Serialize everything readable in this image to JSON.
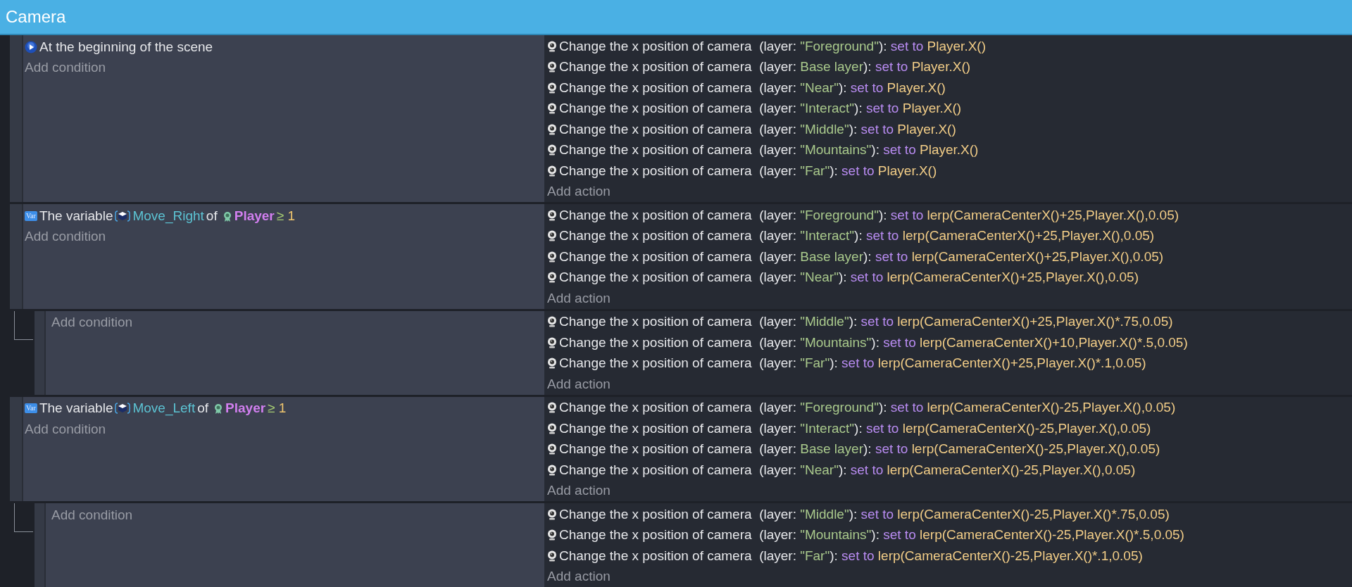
{
  "header": {
    "title": "Camera"
  },
  "events": [
    {
      "conditions": [
        {
          "kind": "scene_start",
          "text": "At the beginning of the scene"
        }
      ],
      "add_condition": "Add condition",
      "actions": [
        {
          "text": "Change the x position of camera",
          "open": "(layer:",
          "layer": "\"Foreground\"",
          "close": "):",
          "verb": "set to",
          "value": "Player.X()"
        },
        {
          "text": "Change the x position of camera",
          "open": "(layer:",
          "layer": "Base layer",
          "close": "):",
          "verb": "set to",
          "value": "Player.X()"
        },
        {
          "text": "Change the x position of camera",
          "open": "(layer:",
          "layer": "\"Near\"",
          "close": "):",
          "verb": "set to",
          "value": "Player.X()"
        },
        {
          "text": "Change the x position of camera",
          "open": "(layer:",
          "layer": "\"Interact\"",
          "close": "):",
          "verb": "set to",
          "value": "Player.X()"
        },
        {
          "text": "Change the x position of camera",
          "open": "(layer:",
          "layer": "\"Middle\"",
          "close": "):",
          "verb": "set to",
          "value": "Player.X()"
        },
        {
          "text": "Change the x position of camera",
          "open": "(layer:",
          "layer": "\"Mountains\"",
          "close": "):",
          "verb": "set to",
          "value": "Player.X()"
        },
        {
          "text": "Change the x position of camera",
          "open": "(layer:",
          "layer": "\"Far\"",
          "close": "):",
          "verb": "set to",
          "value": "Player.X()"
        }
      ],
      "add_action": "Add action"
    },
    {
      "conditions": [
        {
          "kind": "variable",
          "badge": "Var",
          "text": "The variable",
          "variable": "Move_Right",
          "of": "of",
          "object": "Player",
          "operator": "≥",
          "value": "1"
        }
      ],
      "add_condition": "Add condition",
      "actions": [
        {
          "text": "Change the x position of camera",
          "open": "(layer:",
          "layer": "\"Foreground\"",
          "close": "):",
          "verb": "set to",
          "value": "lerp(CameraCenterX()+25,Player.X(),0.05)"
        },
        {
          "text": "Change the x position of camera",
          "open": "(layer:",
          "layer": "\"Interact\"",
          "close": "):",
          "verb": "set to",
          "value": "lerp(CameraCenterX()+25,Player.X(),0.05)"
        },
        {
          "text": "Change the x position of camera",
          "open": "(layer:",
          "layer": "Base layer",
          "close": "):",
          "verb": "set to",
          "value": "lerp(CameraCenterX()+25,Player.X(),0.05)"
        },
        {
          "text": "Change the x position of camera",
          "open": "(layer:",
          "layer": "\"Near\"",
          "close": "):",
          "verb": "set to",
          "value": "lerp(CameraCenterX()+25,Player.X(),0.05)"
        }
      ],
      "add_action": "Add action",
      "children": [
        {
          "add_condition": "Add condition",
          "actions": [
            {
              "text": "Change the x position of camera",
              "open": "(layer:",
              "layer": "\"Middle\"",
              "close": "):",
              "verb": "set to",
              "value": "lerp(CameraCenterX()+25,Player.X()*.75,0.05)"
            },
            {
              "text": "Change the x position of camera",
              "open": "(layer:",
              "layer": "\"Mountains\"",
              "close": "):",
              "verb": "set to",
              "value": "lerp(CameraCenterX()+10,Player.X()*.5,0.05)"
            },
            {
              "text": "Change the x position of camera",
              "open": "(layer:",
              "layer": "\"Far\"",
              "close": "):",
              "verb": "set to",
              "value": "lerp(CameraCenterX()+25,Player.X()*.1,0.05)"
            }
          ],
          "add_action": "Add action"
        }
      ]
    },
    {
      "conditions": [
        {
          "kind": "variable",
          "badge": "Var",
          "text": "The variable",
          "variable": "Move_Left",
          "of": "of",
          "object": "Player",
          "operator": "≥",
          "value": "1"
        }
      ],
      "add_condition": "Add condition",
      "actions": [
        {
          "text": "Change the x position of camera",
          "open": "(layer:",
          "layer": "\"Foreground\"",
          "close": "):",
          "verb": "set to",
          "value": "lerp(CameraCenterX()-25,Player.X(),0.05)"
        },
        {
          "text": "Change the x position of camera",
          "open": "(layer:",
          "layer": "\"Interact\"",
          "close": "):",
          "verb": "set to",
          "value": "lerp(CameraCenterX()-25,Player.X(),0.05)"
        },
        {
          "text": "Change the x position of camera",
          "open": "(layer:",
          "layer": "Base layer",
          "close": "):",
          "verb": "set to",
          "value": "lerp(CameraCenterX()-25,Player.X(),0.05)"
        },
        {
          "text": "Change the x position of camera",
          "open": "(layer:",
          "layer": "\"Near\"",
          "close": "):",
          "verb": "set to",
          "value": "lerp(CameraCenterX()-25,Player.X(),0.05)"
        }
      ],
      "add_action": "Add action",
      "children": [
        {
          "add_condition": "Add condition",
          "actions": [
            {
              "text": "Change the x position of camera",
              "open": "(layer:",
              "layer": "\"Middle\"",
              "close": "):",
              "verb": "set to",
              "value": "lerp(CameraCenterX()-25,Player.X()*.75,0.05)"
            },
            {
              "text": "Change the x position of camera",
              "open": "(layer:",
              "layer": "\"Mountains\"",
              "close": "):",
              "verb": "set to",
              "value": "lerp(CameraCenterX()-25,Player.X()*.5,0.05)"
            },
            {
              "text": "Change the x position of camera",
              "open": "(layer:",
              "layer": "\"Far\"",
              "close": "):",
              "verb": "set to",
              "value": "lerp(CameraCenterX()-25,Player.X()*.1,0.05)"
            }
          ],
          "add_action": "Add action"
        }
      ]
    }
  ]
}
